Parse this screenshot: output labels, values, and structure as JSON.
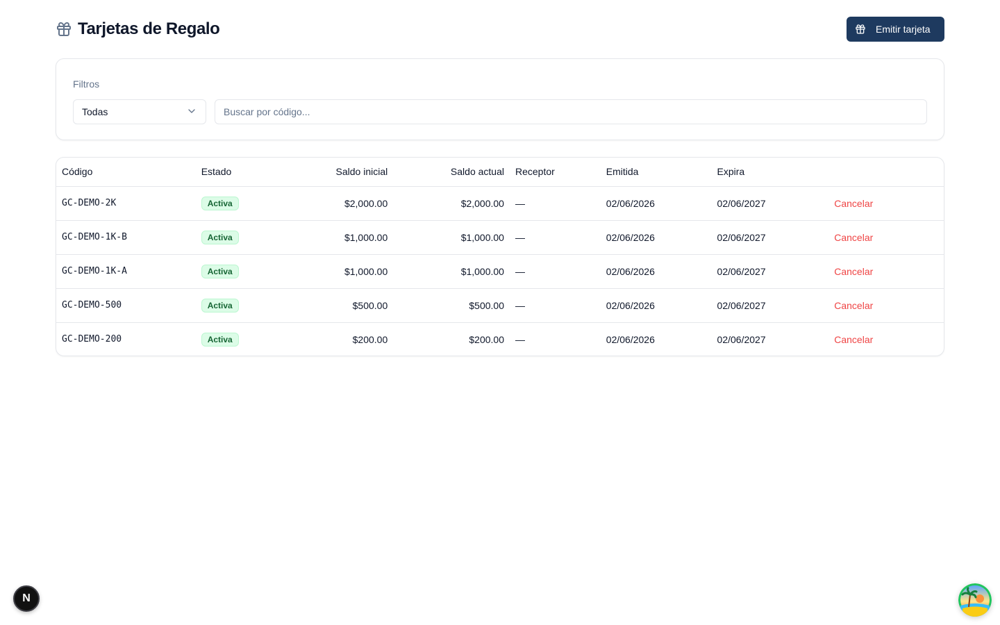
{
  "header": {
    "title": "Tarjetas de Regalo",
    "title_icon": "gift-icon",
    "issue_button_label": "Emitir tarjeta",
    "issue_button_icon": "gift-icon",
    "accent_color": "#1e3a5f"
  },
  "filters": {
    "label": "Filtros",
    "status_select_value": "Todas",
    "search_placeholder": "Buscar por código..."
  },
  "table": {
    "columns": [
      "Código",
      "Estado",
      "Saldo inicial",
      "Saldo actual",
      "Receptor",
      "Emitida",
      "Expira",
      ""
    ],
    "rows": [
      {
        "code": "GC-DEMO-2K",
        "status": "Activa",
        "initial": "$2,000.00",
        "current": "$2,000.00",
        "recipient": "—",
        "issued": "02/06/2026",
        "expires": "02/06/2027",
        "action": "Cancelar"
      },
      {
        "code": "GC-DEMO-1K-B",
        "status": "Activa",
        "initial": "$1,000.00",
        "current": "$1,000.00",
        "recipient": "—",
        "issued": "02/06/2026",
        "expires": "02/06/2027",
        "action": "Cancelar"
      },
      {
        "code": "GC-DEMO-1K-A",
        "status": "Activa",
        "initial": "$1,000.00",
        "current": "$1,000.00",
        "recipient": "—",
        "issued": "02/06/2026",
        "expires": "02/06/2027",
        "action": "Cancelar"
      },
      {
        "code": "GC-DEMO-500",
        "status": "Activa",
        "initial": "$500.00",
        "current": "$500.00",
        "recipient": "—",
        "issued": "02/06/2026",
        "expires": "02/06/2027",
        "action": "Cancelar"
      },
      {
        "code": "GC-DEMO-200",
        "status": "Activa",
        "initial": "$200.00",
        "current": "$200.00",
        "recipient": "—",
        "issued": "02/06/2026",
        "expires": "02/06/2027",
        "action": "Cancelar"
      }
    ],
    "status_color": "#166534",
    "cancel_color": "#ef4444"
  },
  "floating": {
    "dev_badge_letter": "N",
    "dev_badge_icon": "nextjs-icon",
    "avatar_icon": "beach-avatar-icon"
  }
}
